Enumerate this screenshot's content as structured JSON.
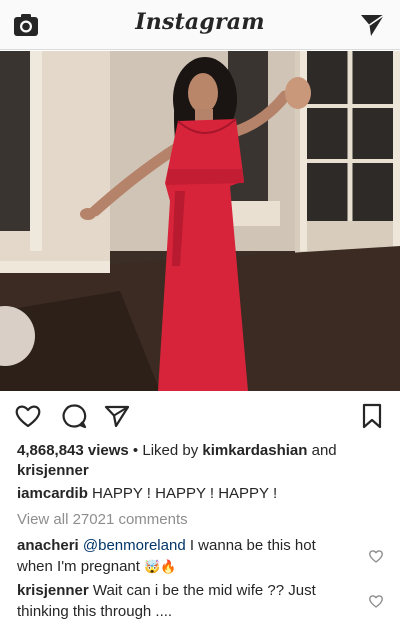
{
  "header": {
    "logo": "Instagram",
    "camera_icon": "camera-icon",
    "direct_icon": "paper-plane-icon"
  },
  "post": {
    "media_alt": "Woman in a red dress dancing in a room",
    "actions": {
      "like_icon": "heart-icon",
      "comment_icon": "speech-bubble-icon",
      "share_icon": "paper-plane-icon",
      "save_icon": "bookmark-icon"
    },
    "views": "4,868,843 views",
    "liked_by_prefix": " • Liked by ",
    "liked_user": "kimkardashian",
    "liked_and": " and",
    "liked_user2": "krisjenner",
    "caption": {
      "user": "iamcardib",
      "text": " HAPPY ! HAPPY ! HAPPY !"
    },
    "view_all": "View all 27021 comments",
    "comments": [
      {
        "user": "anacheri",
        "mention": "@benmoreland",
        "text_a": " I wanna be this hot",
        "text_b": "when I'm pregnant ",
        "emoji": "🤯🔥"
      },
      {
        "user": "krisjenner",
        "text_a": " Wait can i be the mid wife ?? Just",
        "text_b": "thinking this through ...."
      }
    ]
  }
}
